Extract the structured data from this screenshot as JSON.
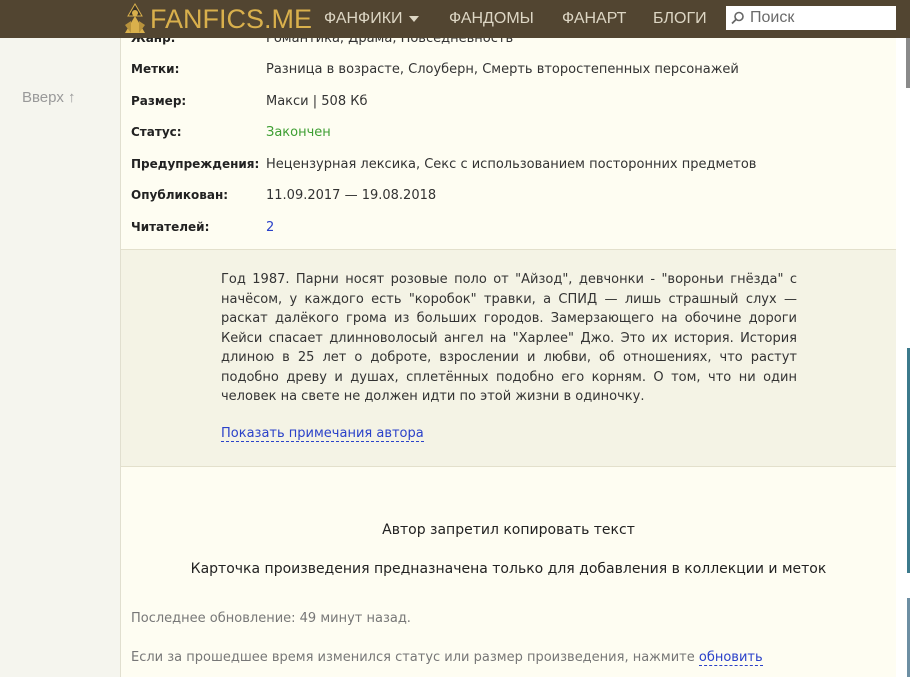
{
  "header": {
    "logo_text": "FANFICS.ME",
    "nav": [
      {
        "label": "ФАНФИКИ"
      },
      {
        "label": "ФАНДОМЫ"
      },
      {
        "label": "ФАНАРТ"
      },
      {
        "label": "БЛОГИ"
      }
    ],
    "search_placeholder": "Поиск"
  },
  "sidebar": {
    "up_link": "Вверх ↑"
  },
  "meta": [
    {
      "label": "Жанр:",
      "value": "Романтика, Драма, Повседневность"
    },
    {
      "label": "Метки:",
      "value": "Разница в возрасте, Слоуберн, Смерть второстепенных персонажей"
    },
    {
      "label": "Размер:",
      "value": "Макси | 508 Кб"
    },
    {
      "label": "Статус:",
      "value": "Закончен"
    },
    {
      "label": "Предупреждения:",
      "value": "Нецензурная лексика, Секс с использованием посторонних предметов"
    },
    {
      "label": "Опубликован:",
      "value": "11.09.2017 — 19.08.2018"
    },
    {
      "label": "Читателей:",
      "value": "2"
    }
  ],
  "summary": {
    "text": "Год 1987. Парни носят розовые поло от \"Айзод\", девчонки - \"вороньи гнёзда\" с начёсом, у каждого есть \"коробок\" травки, а СПИД — лишь страшный слух — раскат далёкого грома из больших городов. Замерзающего на обочине дороги Кейси спасает длинноволосый ангел на \"Харлее\" Джо. Это их история. История длиною в 25 лет о доброте, взрослении и любви, об отношениях, что растут подобно древу и душах, сплетённых подобно его корням. О том, что ни один человек на свете не должен идти по этой жизни в одиночку.",
    "author_notes_link": "Показать примечания автора"
  },
  "notices": {
    "copy_forbidden": "Автор запретил копировать текст",
    "card_note": "Карточка произведения предназначена только для добавления в коллекции и меток",
    "last_update": "Последнее обновление: 49 минут назад.",
    "refresh_text": "Если за прошедшее время изменился статус или размер произведения, нажмите",
    "refresh_link": "обновить"
  },
  "colors": {
    "header_bg": "#524531",
    "logo": "#d9b04c",
    "status_green": "#3d9e32",
    "link_blue": "#2a41c9"
  }
}
